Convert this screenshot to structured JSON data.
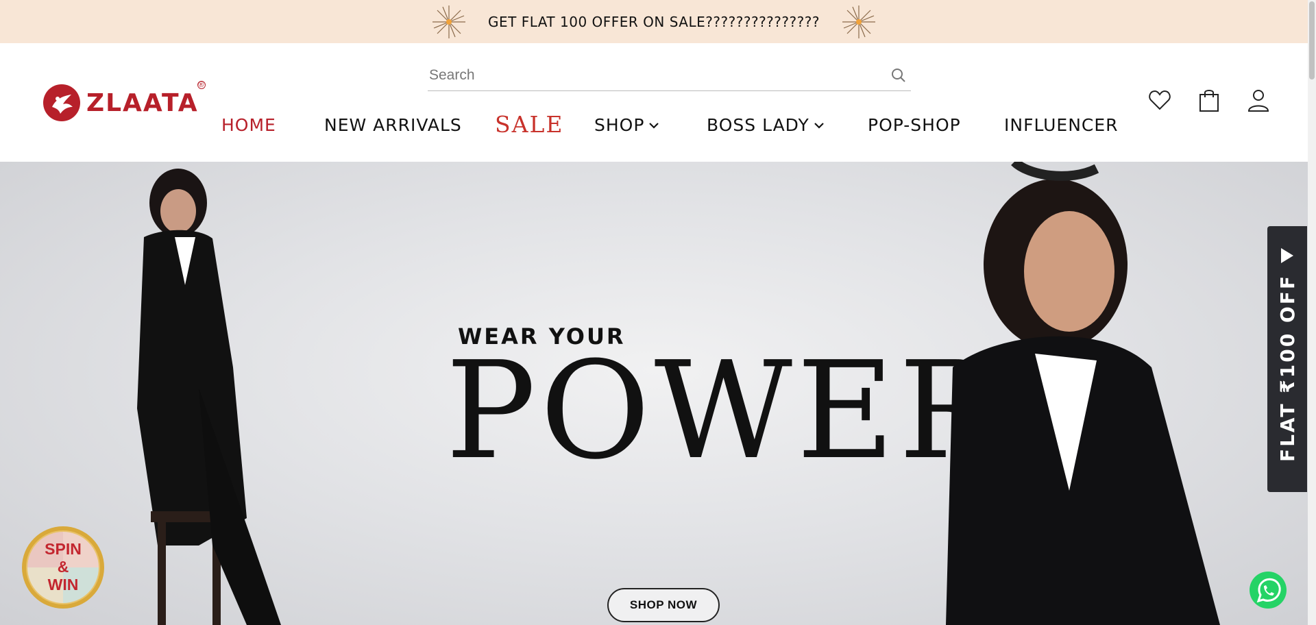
{
  "announcement": {
    "text": "GET FLAT 100 OFFER ON SALE???????????????",
    "icon_left": "firework-icon",
    "icon_right": "firework-icon"
  },
  "header": {
    "brand": "ZLAATA",
    "reg_mark": "®",
    "search": {
      "placeholder": "Search",
      "value": ""
    },
    "nav": [
      {
        "label": "HOME",
        "active": true
      },
      {
        "label": "NEW ARRIVALS"
      },
      {
        "label": "SALE"
      },
      {
        "label": "SHOP",
        "dropdown": true
      },
      {
        "label": "BOSS LADY",
        "dropdown": true
      },
      {
        "label": "POP-SHOP"
      },
      {
        "label": "INFLUENCER"
      }
    ],
    "icons": [
      "heart-icon",
      "shopping-bag-icon",
      "user-icon"
    ]
  },
  "hero": {
    "kicker": "WEAR YOUR",
    "headline": "POWER",
    "cta": "SHOP NOW"
  },
  "side_tab": {
    "label": "FLAT ₹100 OFF"
  },
  "spin_widget": {
    "line1": "SPIN",
    "line2": "&",
    "line3": "WIN"
  },
  "colors": {
    "brand": "#b7202a",
    "announce_bg": "#f8e6d6",
    "side_tab_bg": "#2a2b30",
    "whatsapp": "#25d366"
  }
}
